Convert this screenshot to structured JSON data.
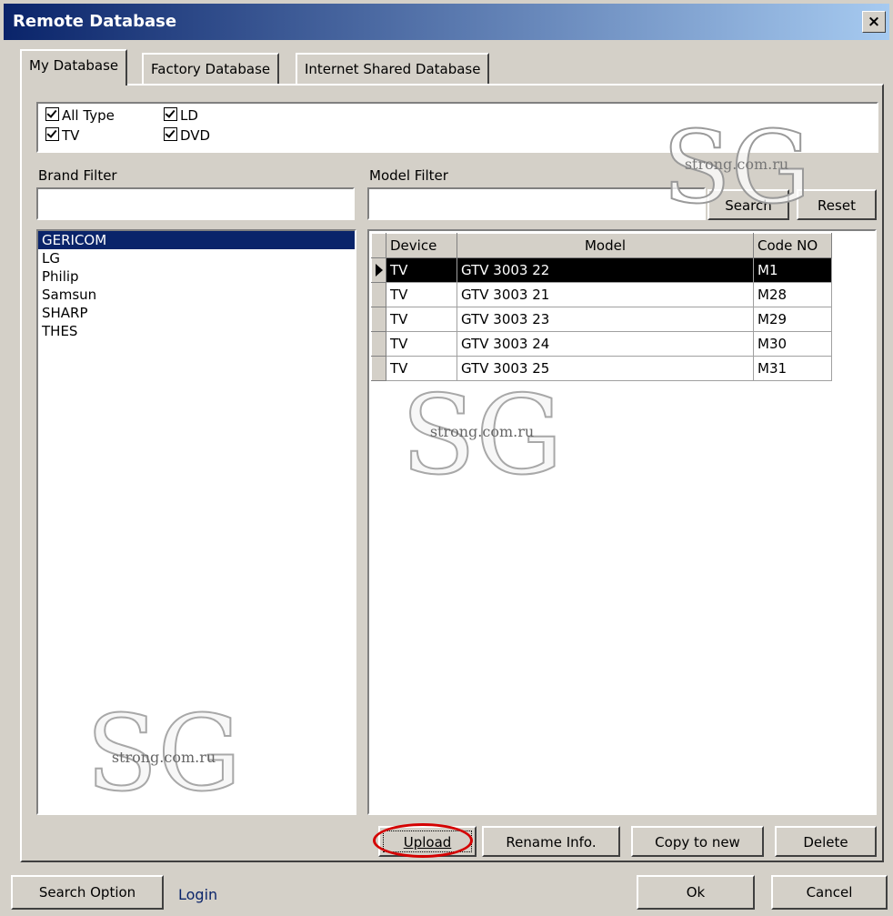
{
  "window": {
    "title": "Remote Database",
    "close_label": "×"
  },
  "tabs": [
    {
      "label": "My Database",
      "active": true
    },
    {
      "label": "Factory Database",
      "active": false
    },
    {
      "label": "Internet Shared Database",
      "active": false
    }
  ],
  "type_filter": [
    {
      "label": "All Type",
      "checked": true
    },
    {
      "label": "TV",
      "checked": true
    },
    {
      "label": "LD",
      "checked": true
    },
    {
      "label": "DVD",
      "checked": true
    }
  ],
  "brand_filter": {
    "label": "Brand Filter",
    "value": ""
  },
  "model_filter": {
    "label": "Model Filter",
    "value": ""
  },
  "buttons": {
    "search": "Search",
    "reset": "Reset",
    "upload": "Upload",
    "rename": "Rename Info.",
    "copy": "Copy to new",
    "delete": "Delete",
    "search_option": "Search Option",
    "ok": "Ok",
    "cancel": "Cancel"
  },
  "login_link": "Login",
  "brands": [
    {
      "name": "GERICOM",
      "selected": true
    },
    {
      "name": "LG"
    },
    {
      "name": "Philip"
    },
    {
      "name": "Samsun"
    },
    {
      "name": "SHARP"
    },
    {
      "name": "THES"
    }
  ],
  "grid": {
    "columns": [
      "Device",
      "Model",
      "Code NO"
    ],
    "rows": [
      {
        "device": "TV",
        "model": "GTV 3003 22",
        "code": "M1",
        "selected": true
      },
      {
        "device": "TV",
        "model": "GTV 3003 21",
        "code": "M28"
      },
      {
        "device": "TV",
        "model": "GTV 3003 23",
        "code": "M29"
      },
      {
        "device": "TV",
        "model": "GTV 3003 24",
        "code": "M30"
      },
      {
        "device": "TV",
        "model": "GTV 3003 25",
        "code": "M31"
      }
    ]
  },
  "watermark": {
    "text": "strong.com.ru",
    "logo": "SG"
  },
  "colors": {
    "selection": "#0a246a",
    "highlight_ring": "#d40000",
    "dialog_bg": "#d4d0c8"
  }
}
